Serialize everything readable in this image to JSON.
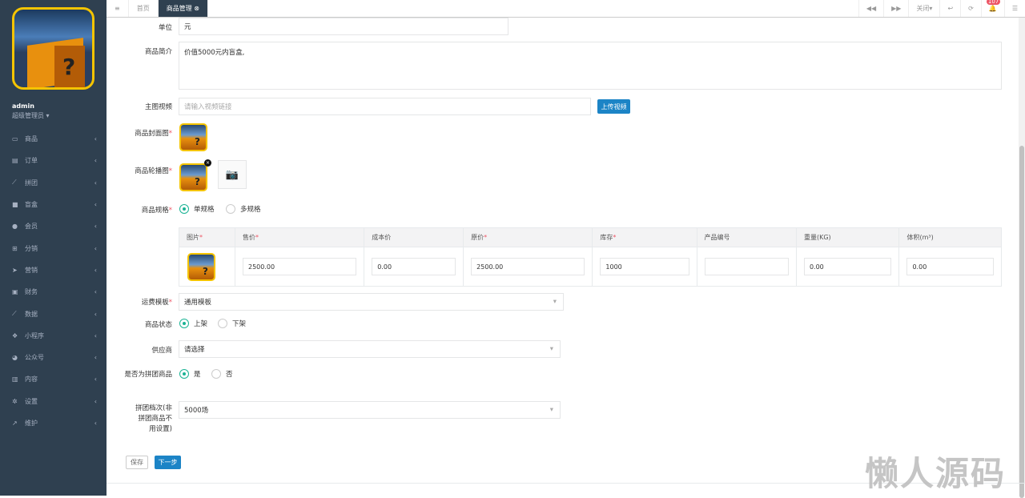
{
  "sidebar": {
    "user": "admin",
    "role": "超级管理员 ▾",
    "items": [
      {
        "label": "商品",
        "icon": "laptop-icon"
      },
      {
        "label": "订单",
        "icon": "file-icon"
      },
      {
        "label": "拼团",
        "icon": "chart-icon"
      },
      {
        "label": "盲盒",
        "icon": "square-icon"
      },
      {
        "label": "会员",
        "icon": "user-icon"
      },
      {
        "label": "分销",
        "icon": "sitemap-icon"
      },
      {
        "label": "营销",
        "icon": "send-icon"
      },
      {
        "label": "财务",
        "icon": "money-icon"
      },
      {
        "label": "数据",
        "icon": "chart-icon"
      },
      {
        "label": "小程序",
        "icon": "cubes-icon"
      },
      {
        "label": "公众号",
        "icon": "wechat-icon"
      },
      {
        "label": "内容",
        "icon": "book-icon"
      },
      {
        "label": "设置",
        "icon": "gear-icon"
      },
      {
        "label": "维护",
        "icon": "magic-icon"
      }
    ]
  },
  "topbar": {
    "home": "首页",
    "active_tab": "商品管理",
    "close": "关闭▾",
    "badge": "107"
  },
  "form": {
    "unit_label": "单位",
    "unit_value": "元",
    "intro_label": "商品简介",
    "intro_value": "价值5000元内盲盒,",
    "video_label": "主图视频",
    "video_placeholder": "请输入视频链接",
    "upload_video": "上传视频",
    "cover_label": "商品封面图",
    "carousel_label": "商品轮播图",
    "spec_label": "商品规格",
    "spec_single": "单规格",
    "spec_multi": "多规格",
    "table": {
      "headers": [
        {
          "t": "图片",
          "r": true
        },
        {
          "t": "售价",
          "r": true
        },
        {
          "t": "成本价",
          "r": false
        },
        {
          "t": "原价",
          "r": true
        },
        {
          "t": "库存",
          "r": true
        },
        {
          "t": "产品编号",
          "r": false
        },
        {
          "t": "重量(KG)",
          "r": false
        },
        {
          "t": "体积(m³)",
          "r": false
        }
      ],
      "row": [
        "2500.00",
        "0.00",
        "2500.00",
        "1000",
        "",
        "0.00",
        "0.00"
      ]
    },
    "shipping_label": "运费模板",
    "shipping_value": "通用模板",
    "status_label": "商品状态",
    "status_on": "上架",
    "status_off": "下架",
    "supplier_label": "供应商",
    "supplier_value": "请选择",
    "group_label": "是否为拼团商品",
    "group_yes": "是",
    "group_no": "否",
    "tier_label": "拼团档次(非拼团商品不用设置)",
    "tier_value": "5000场",
    "save": "保存",
    "next": "下一步"
  },
  "watermark": "懒人源码"
}
